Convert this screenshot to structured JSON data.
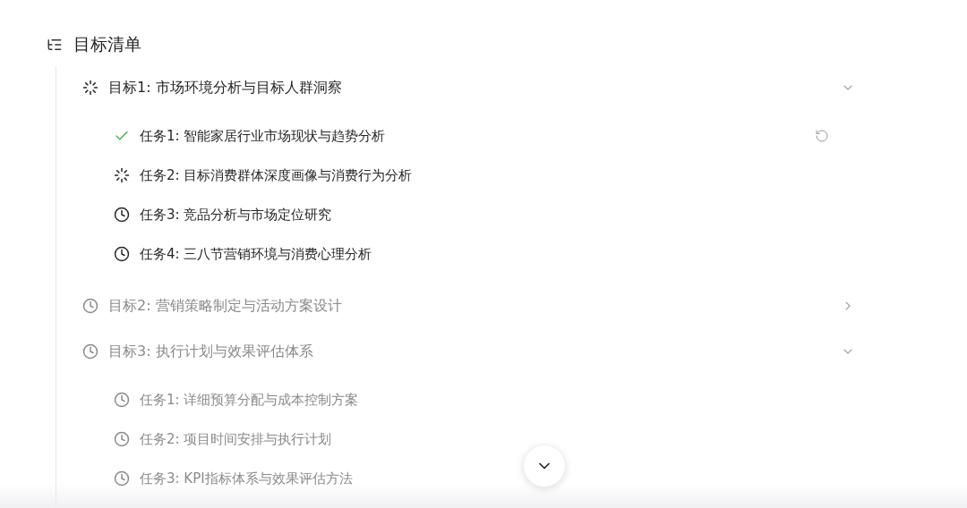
{
  "title": "目标清单",
  "goals": [
    {
      "title": "目标1: 市场环境分析与目标人群洞察",
      "kind": "running",
      "expanded": true,
      "tasks": [
        {
          "title": "任务1: 智能家居行业市场现状与趋势分析",
          "kind": "done",
          "retry": true
        },
        {
          "title": "任务2: 目标消费群体深度画像与消费行为分析",
          "kind": "running",
          "retry": false
        },
        {
          "title": "任务3: 竞品分析与市场定位研究",
          "kind": "pending",
          "retry": false
        },
        {
          "title": "任务4: 三八节营销环境与消费心理分析",
          "kind": "pending",
          "retry": false
        }
      ]
    },
    {
      "title": "目标2: 营销策略制定与活动方案设计",
      "kind": "pending",
      "expanded": false
    },
    {
      "title": "目标3: 执行计划与效果评估体系",
      "kind": "pending",
      "expanded": true,
      "tasks": [
        {
          "title": "任务1: 详细预算分配与成本控制方案",
          "kind": "pending",
          "retry": false
        },
        {
          "title": "任务2: 项目时间安排与执行计划",
          "kind": "pending",
          "retry": false
        },
        {
          "title": "任务3: KPI指标体系与效果评估方法",
          "kind": "pending",
          "retry": false
        }
      ]
    }
  ]
}
